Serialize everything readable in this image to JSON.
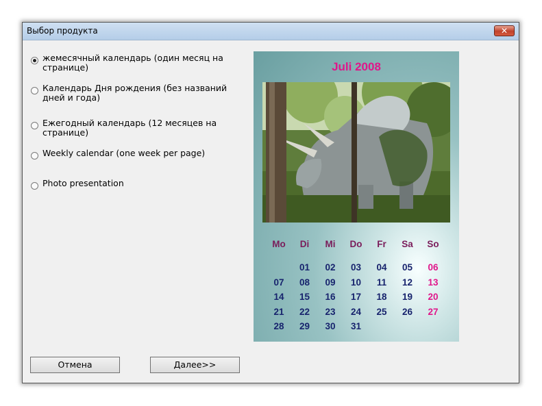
{
  "window": {
    "title": "Выбор продукта",
    "close_glyph": "✕"
  },
  "options": [
    {
      "label": "жемесячный календарь (один месяц на странице)",
      "checked": true
    },
    {
      "label": "Календарь Дня рождения (без названий дней и года)",
      "checked": false
    },
    {
      "label": "Ежегодный календарь (12 месяцев на странице)",
      "checked": false
    },
    {
      "label": "Weekly calendar (one week per page)",
      "checked": false
    },
    {
      "label": "Photo presentation",
      "checked": false
    }
  ],
  "preview": {
    "month_title": "Juli 2008",
    "photo_icon": "triceratops-photo",
    "day_names": [
      "Mo",
      "Di",
      "Mi",
      "Do",
      "Fr",
      "Sa",
      "So"
    ],
    "weeks": [
      [
        "",
        "01",
        "02",
        "03",
        "04",
        "05",
        "06"
      ],
      [
        "07",
        "08",
        "09",
        "10",
        "11",
        "12",
        "13"
      ],
      [
        "14",
        "15",
        "16",
        "17",
        "18",
        "19",
        "20"
      ],
      [
        "21",
        "22",
        "23",
        "24",
        "25",
        "26",
        "27"
      ],
      [
        "28",
        "29",
        "30",
        "31",
        "",
        "",
        ""
      ]
    ],
    "colors": {
      "title": "#e0168a",
      "day_name": "#7a1c5a",
      "date": "#17236d",
      "sunday": "#e0168a"
    }
  },
  "buttons": {
    "cancel": "Отмена",
    "next": "Далее>>"
  }
}
